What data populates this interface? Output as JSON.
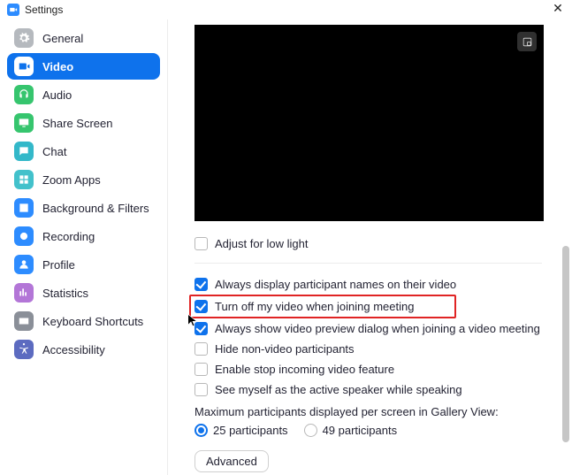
{
  "window": {
    "title": "Settings"
  },
  "sidebar": {
    "items": [
      {
        "label": "General",
        "icon": "gear",
        "color": "#B5B9BE",
        "active": false
      },
      {
        "label": "Video",
        "icon": "camera",
        "color": "#0E72EC",
        "active": true
      },
      {
        "label": "Audio",
        "icon": "headset",
        "color": "#36C56E",
        "active": false
      },
      {
        "label": "Share Screen",
        "icon": "screen",
        "color": "#36C56E",
        "active": false
      },
      {
        "label": "Chat",
        "icon": "chat",
        "color": "#33B8C9",
        "active": false
      },
      {
        "label": "Zoom Apps",
        "icon": "apps",
        "color": "#42C1CB",
        "active": false
      },
      {
        "label": "Background & Filters",
        "icon": "bgfilter",
        "color": "#2D8CFF",
        "active": false
      },
      {
        "label": "Recording",
        "icon": "record",
        "color": "#2D8CFF",
        "active": false
      },
      {
        "label": "Profile",
        "icon": "profile",
        "color": "#2D8CFF",
        "active": false
      },
      {
        "label": "Statistics",
        "icon": "stats",
        "color": "#B376D7",
        "active": false
      },
      {
        "label": "Keyboard Shortcuts",
        "icon": "keyboard",
        "color": "#8A8F98",
        "active": false
      },
      {
        "label": "Accessibility",
        "icon": "a11y",
        "color": "#5C6BC0",
        "active": false
      }
    ]
  },
  "content": {
    "adjust_low_light": {
      "label": "Adjust for low light",
      "checked": false
    },
    "checks": {
      "always_names": {
        "label": "Always display participant names on their video",
        "checked": true
      },
      "turn_off_join": {
        "label": "Turn off my video when joining meeting",
        "checked": true
      },
      "always_preview": {
        "label": "Always show video preview dialog when joining a video meeting",
        "checked": true
      },
      "hide_nonvideo": {
        "label": "Hide non-video participants",
        "checked": false
      },
      "stop_incoming": {
        "label": "Enable stop incoming video feature",
        "checked": false
      },
      "see_myself": {
        "label": "See myself as the active speaker while speaking",
        "checked": false
      }
    },
    "gallery_caption": "Maximum participants displayed per screen in Gallery View:",
    "gallery_options": {
      "opt25": {
        "label": "25 participants",
        "selected": true
      },
      "opt49": {
        "label": "49 participants",
        "selected": false
      }
    },
    "advanced_label": "Advanced"
  }
}
